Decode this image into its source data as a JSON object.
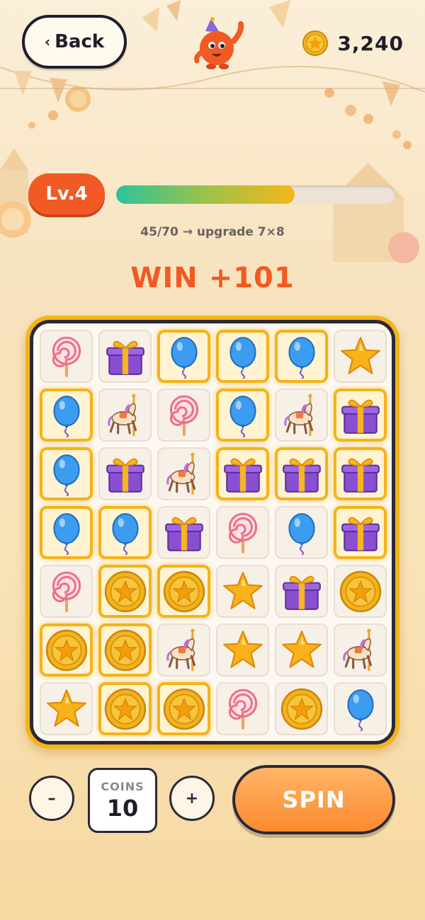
{
  "header": {
    "back_label": "Back",
    "back_chevron": "‹",
    "coins": "3,240",
    "mascot_icon": "party-mascot-icon"
  },
  "level": {
    "label": "Lv.4",
    "progress_text": "45/70 → upgrade 7×8",
    "progress_fraction": 0.64
  },
  "win_text": "WIN +101",
  "board": {
    "rows": [
      [
        "lollipop",
        "gift",
        "balloon",
        "balloon",
        "balloon",
        "star"
      ],
      [
        "balloon",
        "carousel-horse",
        "lollipop",
        "balloon",
        "carousel-horse",
        "gift"
      ],
      [
        "balloon",
        "gift",
        "carousel-horse",
        "gift",
        "gift",
        "gift"
      ],
      [
        "balloon",
        "balloon",
        "gift",
        "lollipop",
        "balloon",
        "gift"
      ],
      [
        "lollipop",
        "coin",
        "coin",
        "star",
        "gift",
        "coin"
      ],
      [
        "coin",
        "coin",
        "carousel-horse",
        "star",
        "star",
        "carousel-horse"
      ],
      [
        "star",
        "coin",
        "coin",
        "lollipop",
        "coin",
        "balloon"
      ]
    ],
    "winning": [
      [
        false,
        false,
        true,
        true,
        true,
        false
      ],
      [
        true,
        false,
        false,
        true,
        false,
        true
      ],
      [
        true,
        false,
        false,
        true,
        true,
        true
      ],
      [
        true,
        true,
        false,
        false,
        false,
        true
      ],
      [
        false,
        true,
        true,
        false,
        false,
        false
      ],
      [
        true,
        true,
        false,
        false,
        false,
        false
      ],
      [
        false,
        true,
        true,
        false,
        false,
        false
      ]
    ]
  },
  "controls": {
    "minus_label": "–",
    "plus_label": "+",
    "bet_label": "COINS",
    "bet_value": "10",
    "spin_label": "SPIN"
  },
  "colors": {
    "accent": "#f15a24",
    "gold": "#f4b31a",
    "outline": "#2b2936"
  }
}
